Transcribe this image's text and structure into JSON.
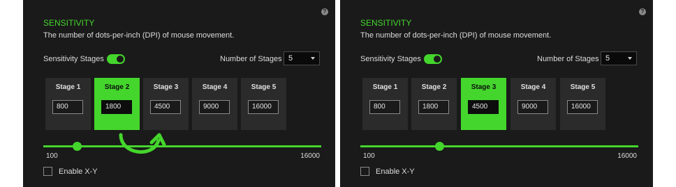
{
  "accent_color": "#44d62c",
  "panels": [
    {
      "title": "SENSITIVITY",
      "description": "The number of dots-per-inch (DPI) of mouse movement.",
      "sensitivity_stages_label": "Sensitivity Stages",
      "sensitivity_stages_enabled": true,
      "number_of_stages_label": "Number of Stages",
      "number_of_stages_value": "5",
      "stages": [
        {
          "label": "Stage 1",
          "value": "800",
          "active": false
        },
        {
          "label": "Stage 2",
          "value": "1800",
          "active": true
        },
        {
          "label": "Stage 3",
          "value": "4500",
          "active": false
        },
        {
          "label": "Stage 4",
          "value": "9000",
          "active": false
        },
        {
          "label": "Stage 5",
          "value": "16000",
          "active": false
        }
      ],
      "slider_min": "100",
      "slider_max": "16000",
      "slider_value": 1800,
      "enable_xy_label": "Enable X-Y",
      "enable_xy_checked": false,
      "help_icon": "question-icon"
    },
    {
      "title": "SENSITIVITY",
      "description": "The number of dots-per-inch (DPI) of mouse movement.",
      "sensitivity_stages_label": "Sensitivity Stages",
      "sensitivity_stages_enabled": true,
      "number_of_stages_label": "Number of Stages",
      "number_of_stages_value": "5",
      "stages": [
        {
          "label": "Stage 1",
          "value": "800",
          "active": false
        },
        {
          "label": "Stage 2",
          "value": "1800",
          "active": false
        },
        {
          "label": "Stage 3",
          "value": "4500",
          "active": true
        },
        {
          "label": "Stage 4",
          "value": "9000",
          "active": false
        },
        {
          "label": "Stage 5",
          "value": "16000",
          "active": false
        }
      ],
      "slider_min": "100",
      "slider_max": "16000",
      "slider_value": 4500,
      "enable_xy_label": "Enable X-Y",
      "enable_xy_checked": false,
      "help_icon": "question-icon"
    }
  ],
  "annotation_arrow_icon": "curved-arrow-icon"
}
